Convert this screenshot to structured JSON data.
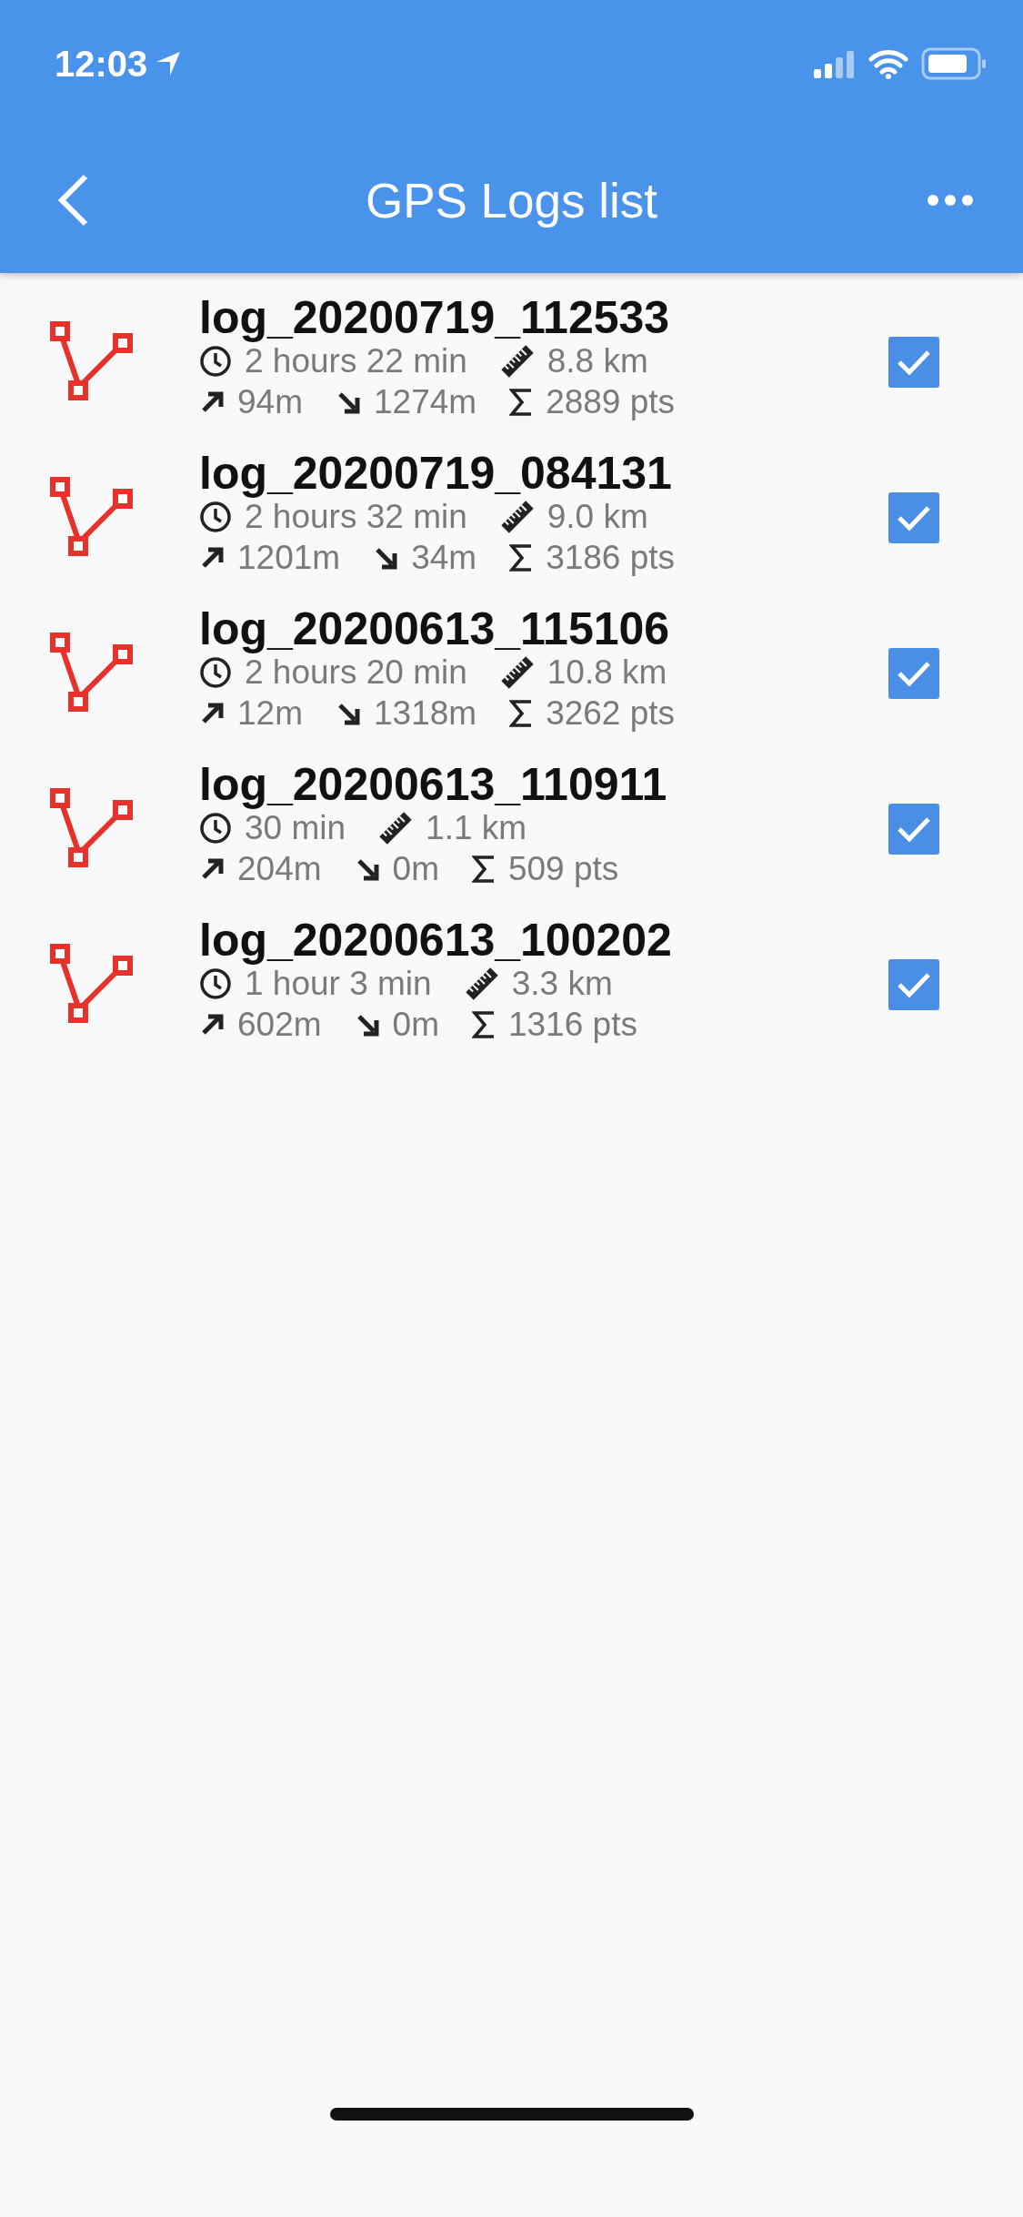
{
  "status_bar": {
    "time": "12:03"
  },
  "nav_bar": {
    "title": "GPS Logs list"
  },
  "logs": [
    {
      "name": "log_20200719_112533",
      "duration": "2 hours 22 min",
      "distance": "8.8 km",
      "ascent": "94m",
      "descent": "1274m",
      "points": "2889 pts",
      "checked": true
    },
    {
      "name": "log_20200719_084131",
      "duration": "2 hours 32 min",
      "distance": "9.0 km",
      "ascent": "1201m",
      "descent": "34m",
      "points": "3186 pts",
      "checked": true
    },
    {
      "name": "log_20200613_115106",
      "duration": "2 hours 20 min",
      "distance": "10.8 km",
      "ascent": "12m",
      "descent": "1318m",
      "points": "3262 pts",
      "checked": true
    },
    {
      "name": "log_20200613_110911",
      "duration": "30 min",
      "distance": "1.1 km",
      "ascent": "204m",
      "descent": "0m",
      "points": "509 pts",
      "checked": true
    },
    {
      "name": "log_20200613_100202",
      "duration": "1 hour 3 min",
      "distance": "3.3 km",
      "ascent": "602m",
      "descent": "0m",
      "points": "1316 pts",
      "checked": true
    }
  ]
}
